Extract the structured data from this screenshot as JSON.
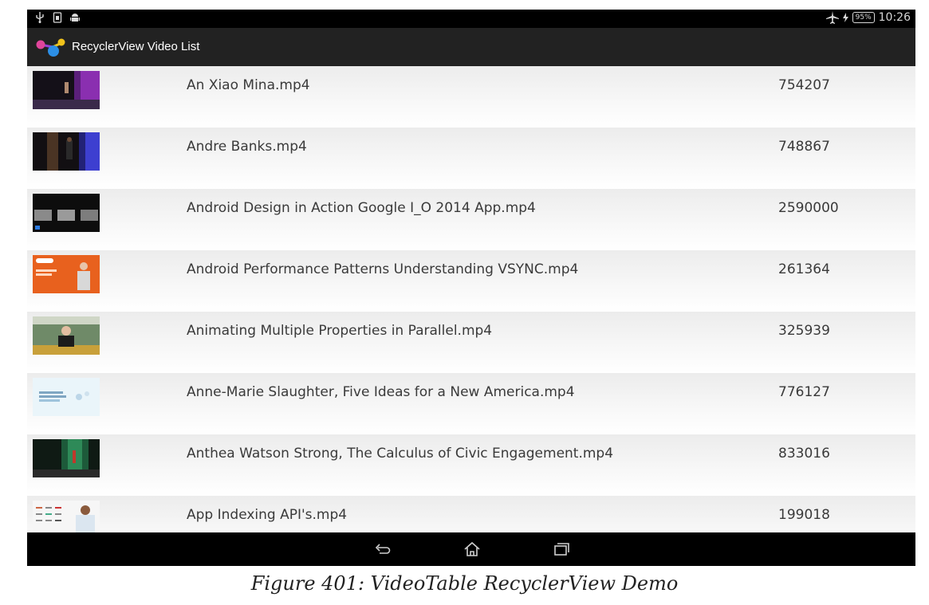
{
  "status_bar": {
    "left_icons": [
      "usb-icon",
      "sim-icon",
      "android-icon"
    ],
    "right_icons": [
      "airplane-icon",
      "charging-icon"
    ],
    "battery": "95%",
    "time": "10:26"
  },
  "action_bar": {
    "app_icon": "recyclerview-app-icon",
    "title": "RecyclerView Video List"
  },
  "videos": [
    {
      "name": "An Xiao Mina.mp4",
      "size": "754207"
    },
    {
      "name": "Andre Banks.mp4",
      "size": "748867"
    },
    {
      "name": "Android Design in Action Google I_O 2014 App.mp4",
      "size": "2590000"
    },
    {
      "name": "Android Performance Patterns Understanding VSYNC.mp4",
      "size": "261364"
    },
    {
      "name": "Animating Multiple Properties in Parallel.mp4",
      "size": "325939"
    },
    {
      "name": "Anne-Marie Slaughter, Five Ideas for a New America.mp4",
      "size": "776127"
    },
    {
      "name": "Anthea Watson Strong, The Calculus of Civic Engagement.mp4",
      "size": "833016"
    },
    {
      "name": "App Indexing API's.mp4",
      "size": "199018"
    }
  ],
  "nav_bar": {
    "buttons": [
      "back-icon",
      "home-icon",
      "recents-icon"
    ]
  },
  "caption": "Figure 401: VideoTable RecyclerView Demo"
}
